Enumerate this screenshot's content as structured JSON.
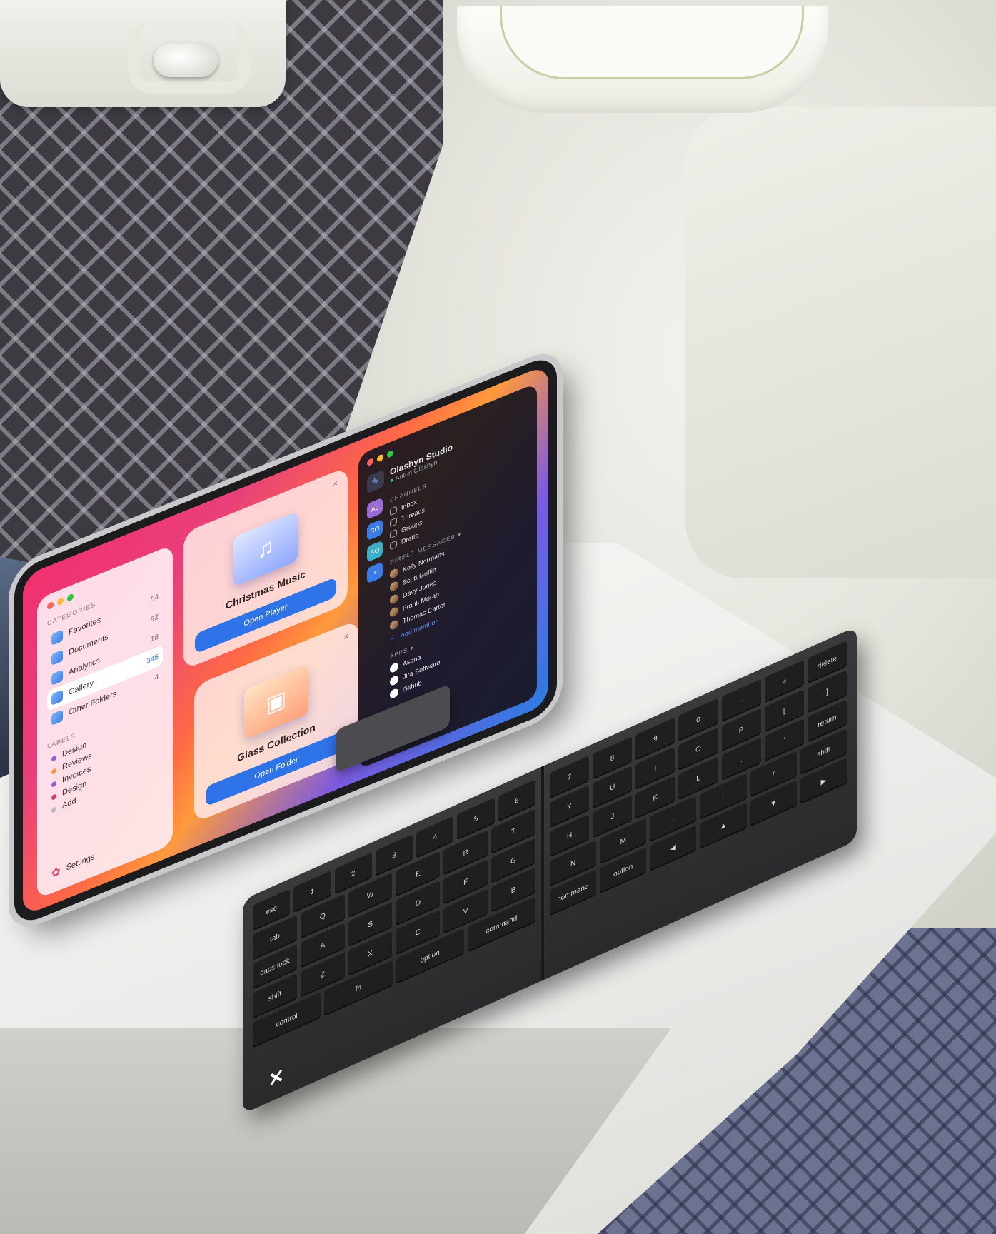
{
  "tablet": {
    "sidebar": {
      "section_categories": "CATEGORIES",
      "categories": [
        {
          "label": "Favorites",
          "count": "54",
          "active": false
        },
        {
          "label": "Documents",
          "count": "92",
          "active": false
        },
        {
          "label": "Analytics",
          "count": "18",
          "active": false
        },
        {
          "label": "Gallery",
          "count": "345",
          "active": true
        },
        {
          "label": "Other Folders",
          "count": "4",
          "active": false
        }
      ],
      "section_labels": "LABELS",
      "labels": [
        {
          "label": "Design",
          "color": "#9b59d6"
        },
        {
          "label": "Reviews",
          "color": "#f39c3a"
        },
        {
          "label": "Invoices",
          "color": "#9b59d6"
        },
        {
          "label": "Design",
          "color": "#d63a6a"
        },
        {
          "label": "Add",
          "color": "#bbbbbb"
        }
      ],
      "settings_label": "Settings"
    },
    "card_music": {
      "title": "Christmas Music",
      "button": "Open Player",
      "close": "×"
    },
    "card_glass": {
      "title": "Glass Collection",
      "button": "Open Folder",
      "close": "×"
    },
    "chat": {
      "studio_name": "Olashyn Studio",
      "studio_user": "Anton Olashyn",
      "rail": [
        {
          "text": "AL",
          "color": "#9b6bd6"
        },
        {
          "text": "SO",
          "color": "#3a7be8"
        },
        {
          "text": "AO",
          "color": "#3ab0c8"
        },
        {
          "text": "+",
          "color": "#3a7be8"
        }
      ],
      "section_channels": "CHANNELS",
      "channels": [
        "Inbox",
        "Threads",
        "Groups",
        "Drafts"
      ],
      "section_dm": "DIRECT MESSAGES ▾",
      "direct_messages": [
        "Kelly Normans",
        "Scott Griffin",
        "Davy Jones",
        "Frank Moran",
        "Thomas Carter"
      ],
      "add_member": "Add member",
      "section_apps": "APPS ▾",
      "apps": [
        "Asana",
        "Jira Software",
        "Github"
      ]
    }
  },
  "keyboard": {
    "left_rows": [
      [
        "esc",
        "1",
        "2",
        "3",
        "4",
        "5",
        "6"
      ],
      [
        "tab",
        "Q",
        "W",
        "E",
        "R",
        "T"
      ],
      [
        "caps lock",
        "A",
        "S",
        "D",
        "F",
        "G"
      ],
      [
        "shift",
        "Z",
        "X",
        "C",
        "V",
        "B"
      ],
      [
        "control",
        "fn",
        "option",
        "command"
      ]
    ],
    "right_rows": [
      [
        "7",
        "8",
        "9",
        "0",
        "-",
        "=",
        "delete"
      ],
      [
        "Y",
        "U",
        "I",
        "O",
        "P",
        "[",
        "]"
      ],
      [
        "H",
        "J",
        "K",
        "L",
        ";",
        "'",
        "return"
      ],
      [
        "N",
        "M",
        ",",
        ".",
        "/",
        "shift"
      ],
      [
        "command",
        "option",
        "◀",
        "▲",
        "▼",
        "▶"
      ]
    ]
  }
}
